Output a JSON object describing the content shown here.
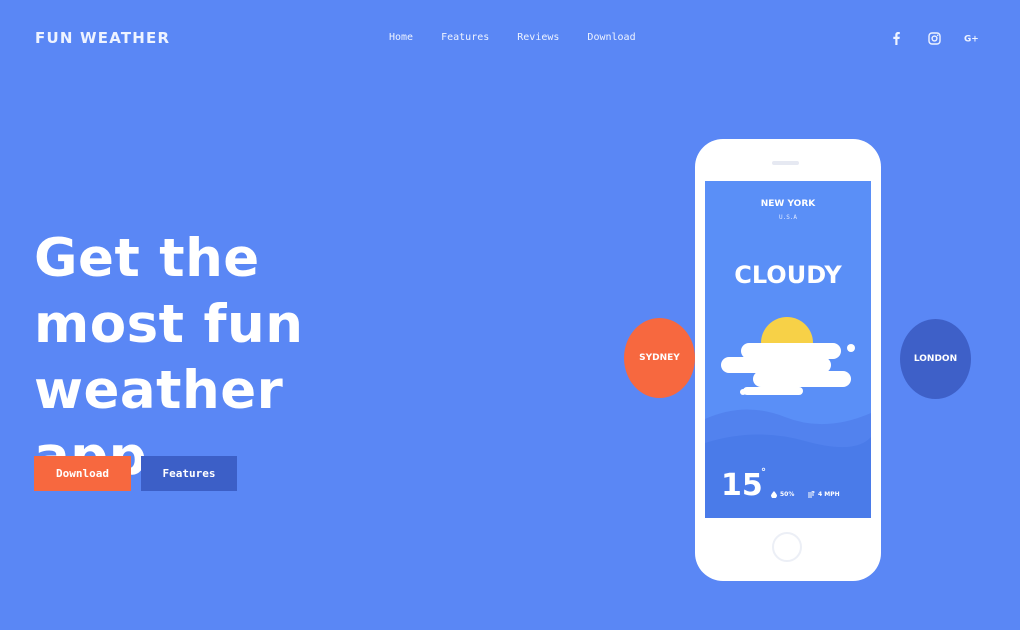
{
  "brand": "FUN WEATHER",
  "nav": [
    {
      "label": "Home"
    },
    {
      "label": "Features"
    },
    {
      "label": "Reviews"
    },
    {
      "label": "Download"
    }
  ],
  "social": [
    {
      "icon": "facebook-icon",
      "glyph": "f"
    },
    {
      "icon": "instagram-icon",
      "glyph": ""
    },
    {
      "icon": "google-plus-icon",
      "glyph": "G+"
    }
  ],
  "hero": {
    "title": "Get the most fun weather app",
    "download_label": "Download",
    "features_label": "Features"
  },
  "phone": {
    "city": "NEW YORK",
    "country": "U.S.A",
    "condition": "CLOUDY",
    "temperature": "15",
    "degree_symbol": "°",
    "humidity": "50%",
    "wind": "4 MPH"
  },
  "bubbles": {
    "left": "SYDNEY",
    "right": "LONDON"
  },
  "colors": {
    "background": "#5a87f5",
    "accent_orange": "#f7683f",
    "accent_blue": "#3c5fc7",
    "sun": "#f7d147"
  }
}
